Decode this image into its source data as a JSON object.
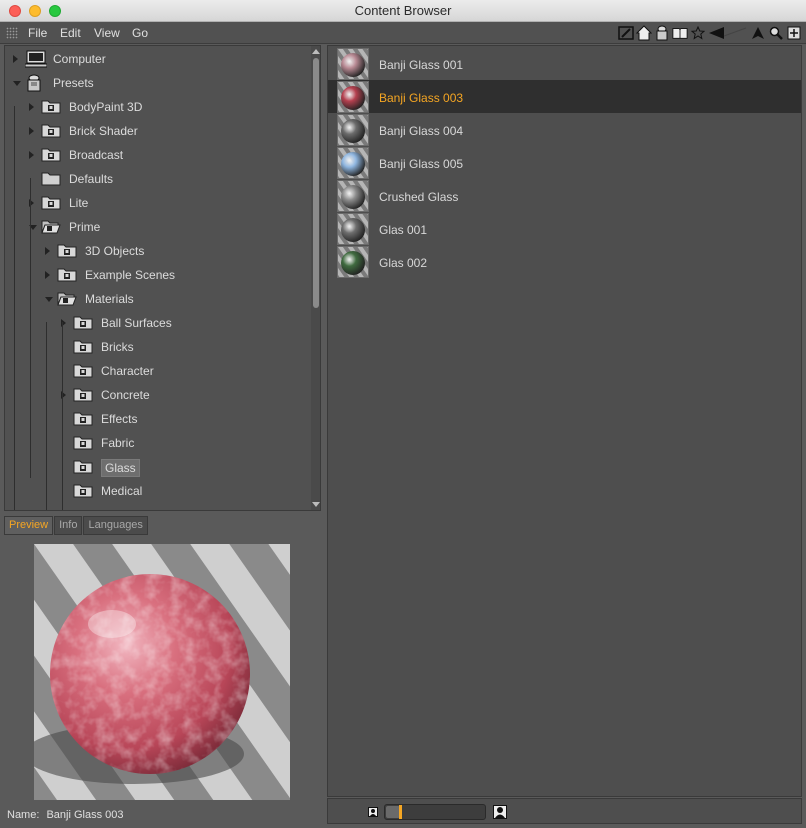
{
  "window": {
    "title": "Content Browser"
  },
  "menu": {
    "items": [
      "File",
      "Edit",
      "View",
      "Go"
    ]
  },
  "toolbar": {
    "icons": [
      "edit-icon",
      "home-icon",
      "presets-icon",
      "catalog-icon",
      "favorite-icon",
      "back-icon",
      "forward-icon",
      "search-icon",
      "new-window-icon"
    ]
  },
  "tree": {
    "items": [
      {
        "label": "Computer",
        "icon": "computer-icon",
        "arrow": "right",
        "indent": 0
      },
      {
        "label": "Presets",
        "icon": "presets-icon",
        "arrow": "down",
        "indent": 0
      },
      {
        "label": "BodyPaint 3D",
        "icon": "library-icon",
        "arrow": "right",
        "indent": 1
      },
      {
        "label": "Brick Shader",
        "icon": "library-icon",
        "arrow": "right",
        "indent": 1
      },
      {
        "label": "Broadcast",
        "icon": "library-icon",
        "arrow": "right",
        "indent": 1
      },
      {
        "label": "Defaults",
        "icon": "folder-icon",
        "arrow": "none",
        "indent": 1
      },
      {
        "label": "Lite",
        "icon": "library-icon",
        "arrow": "right",
        "indent": 1
      },
      {
        "label": "Prime",
        "icon": "library-open-icon",
        "arrow": "down",
        "indent": 1
      },
      {
        "label": "3D Objects",
        "icon": "library-icon",
        "arrow": "right",
        "indent": 2
      },
      {
        "label": "Example Scenes",
        "icon": "library-icon",
        "arrow": "right",
        "indent": 2
      },
      {
        "label": "Materials",
        "icon": "library-open-icon",
        "arrow": "down",
        "indent": 2
      },
      {
        "label": "Ball Surfaces",
        "icon": "library-icon",
        "arrow": "right",
        "indent": 3
      },
      {
        "label": "Bricks",
        "icon": "library-icon",
        "arrow": "none",
        "indent": 3
      },
      {
        "label": "Character",
        "icon": "library-icon",
        "arrow": "none",
        "indent": 3
      },
      {
        "label": "Concrete",
        "icon": "library-icon",
        "arrow": "right",
        "indent": 3
      },
      {
        "label": "Effects",
        "icon": "library-icon",
        "arrow": "none",
        "indent": 3
      },
      {
        "label": "Fabric",
        "icon": "library-icon",
        "arrow": "none",
        "indent": 3
      },
      {
        "label": "Glass",
        "icon": "library-icon",
        "arrow": "none",
        "indent": 3,
        "selected": true
      },
      {
        "label": "Medical",
        "icon": "library-icon",
        "arrow": "none",
        "indent": 3
      }
    ]
  },
  "tabs": [
    {
      "label": "Preview",
      "active": true
    },
    {
      "label": "Info",
      "active": false
    },
    {
      "label": "Languages",
      "active": false
    }
  ],
  "preview": {
    "name_label": "Name:",
    "name_value": "Banji Glass 003"
  },
  "list": {
    "items": [
      {
        "label": "Banji Glass 001",
        "color": "#b98a94",
        "selected": false
      },
      {
        "label": "Banji Glass 003",
        "color": "#b5404f",
        "selected": true
      },
      {
        "label": "Banji Glass 004",
        "color": "#6c6c6c",
        "selected": false
      },
      {
        "label": "Banji Glass 005",
        "color": "#8fb6e0",
        "selected": false
      },
      {
        "label": "Crushed Glass",
        "color": "#8c8c8c",
        "selected": false
      },
      {
        "label": "Glas 001",
        "color": "#6e6e6e",
        "selected": false
      },
      {
        "label": "Glas 002",
        "color": "#3f6b3f",
        "selected": false
      }
    ]
  },
  "thumbnail_size": {
    "level": 0.14
  },
  "colors": {
    "accent": "#f5a623",
    "selection_bg": "#2f2f2f",
    "panel": "#4e4e4e"
  }
}
